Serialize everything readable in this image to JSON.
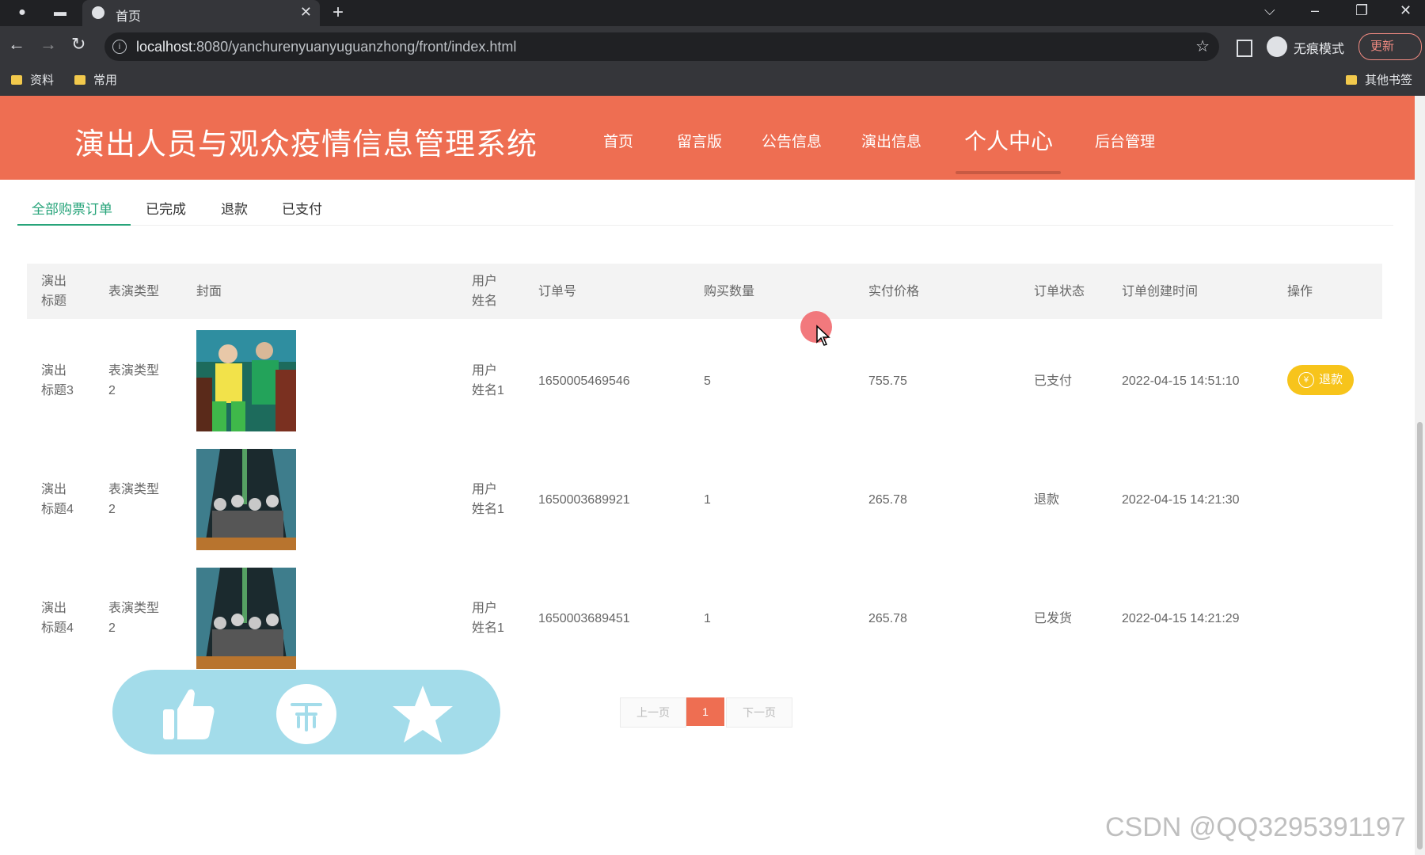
{
  "browser": {
    "tab_title": "首页",
    "url_host": "localhost",
    "url_rest": ":8080/yanchurenyuanyuguanzhong/front/index.html",
    "incognito_label": "无痕模式",
    "update_label": "更新",
    "bookmarks": [
      "资料",
      "常用"
    ],
    "other_bookmarks": "其他书签"
  },
  "site": {
    "title": "演出人员与观众疫情信息管理系统",
    "nav": [
      "首页",
      "留言版",
      "公告信息",
      "演出信息",
      "个人中心",
      "后台管理"
    ],
    "active_nav": "个人中心"
  },
  "order_tabs": [
    "全部购票订单",
    "已完成",
    "退款",
    "已支付"
  ],
  "table": {
    "headers": {
      "title_l1": "演出",
      "title_l2": "标题",
      "type": "表演类型",
      "cover": "封面",
      "user_l1": "用户",
      "user_l2": "姓名",
      "order_no": "订单号",
      "qty": "购买数量",
      "price": "实付价格",
      "status": "订单状态",
      "created": "订单创建时间",
      "action": "操作"
    },
    "rows": [
      {
        "title_l1": "演出",
        "title_l2": "标题3",
        "type_l1": "表演类型",
        "type_l2": "2",
        "user_l1": "用户",
        "user_l2": "姓名1",
        "order_no": "1650005469546",
        "qty": "5",
        "price": "755.75",
        "status": "已支付",
        "created": "2022-04-15 14:51:10",
        "action": "退款"
      },
      {
        "title_l1": "演出",
        "title_l2": "标题4",
        "type_l1": "表演类型",
        "type_l2": "2",
        "user_l1": "用户",
        "user_l2": "姓名1",
        "order_no": "1650003689921",
        "qty": "1",
        "price": "265.78",
        "status": "退款",
        "created": "2022-04-15 14:21:30",
        "action": ""
      },
      {
        "title_l1": "演出",
        "title_l2": "标题4",
        "type_l1": "表演类型",
        "type_l2": "2",
        "user_l1": "用户",
        "user_l2": "姓名1",
        "order_no": "1650003689451",
        "qty": "1",
        "price": "265.78",
        "status": "已发货",
        "created": "2022-04-15 14:21:29",
        "action": ""
      }
    ]
  },
  "pagination": {
    "prev": "上一页",
    "current": "1",
    "next": "下一页"
  },
  "overlay": {
    "icons": [
      "thumbs-up-icon",
      "coin-icon",
      "star-icon"
    ]
  },
  "watermark": "CSDN @QQ3295391197",
  "colors": {
    "header": "#ee6e52",
    "active_tab": "#27a47a",
    "refund_button": "#f7c41b",
    "overlay": "#a3dcea"
  }
}
